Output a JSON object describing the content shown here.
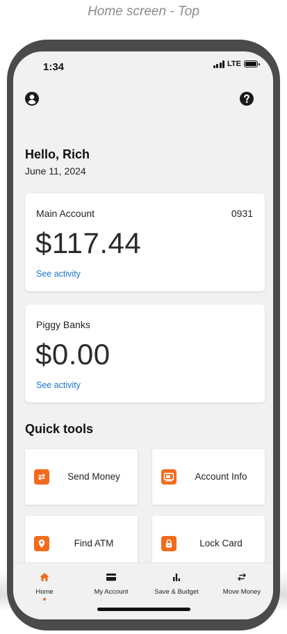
{
  "caption": "Home screen - Top",
  "status_bar": {
    "time": "1:34",
    "network": "LTE"
  },
  "header": {
    "profile_icon": "user-circle-icon",
    "help_icon": "question-circle-icon"
  },
  "greeting": {
    "hello": "Hello, Rich",
    "date": "June 11, 2024"
  },
  "accounts": [
    {
      "name": "Main Account",
      "number": "0931",
      "balance": "$117.44",
      "link": "See activity"
    },
    {
      "name": "Piggy Banks",
      "number": "",
      "balance": "$0.00",
      "link": "See activity"
    }
  ],
  "quick_tools": {
    "title": "Quick tools",
    "items": [
      {
        "label": "Send Money",
        "icon": "transfer-arrows-icon"
      },
      {
        "label": "Account Info",
        "icon": "account-card-icon"
      },
      {
        "label": "Find ATM",
        "icon": "location-pin-icon"
      },
      {
        "label": "Lock Card",
        "icon": "lock-icon"
      }
    ]
  },
  "tab_bar": {
    "active": "Home",
    "items": [
      {
        "label": "Home",
        "icon": "home-icon"
      },
      {
        "label": "My Account",
        "icon": "card-icon"
      },
      {
        "label": "Save & Budget",
        "icon": "bar-chart-icon"
      },
      {
        "label": "Move Money",
        "icon": "transfer-icon"
      }
    ]
  },
  "colors": {
    "accent": "#f26b1d",
    "link": "#1a73c8",
    "background": "#f1f1f1",
    "frame": "#4b4b4b"
  }
}
